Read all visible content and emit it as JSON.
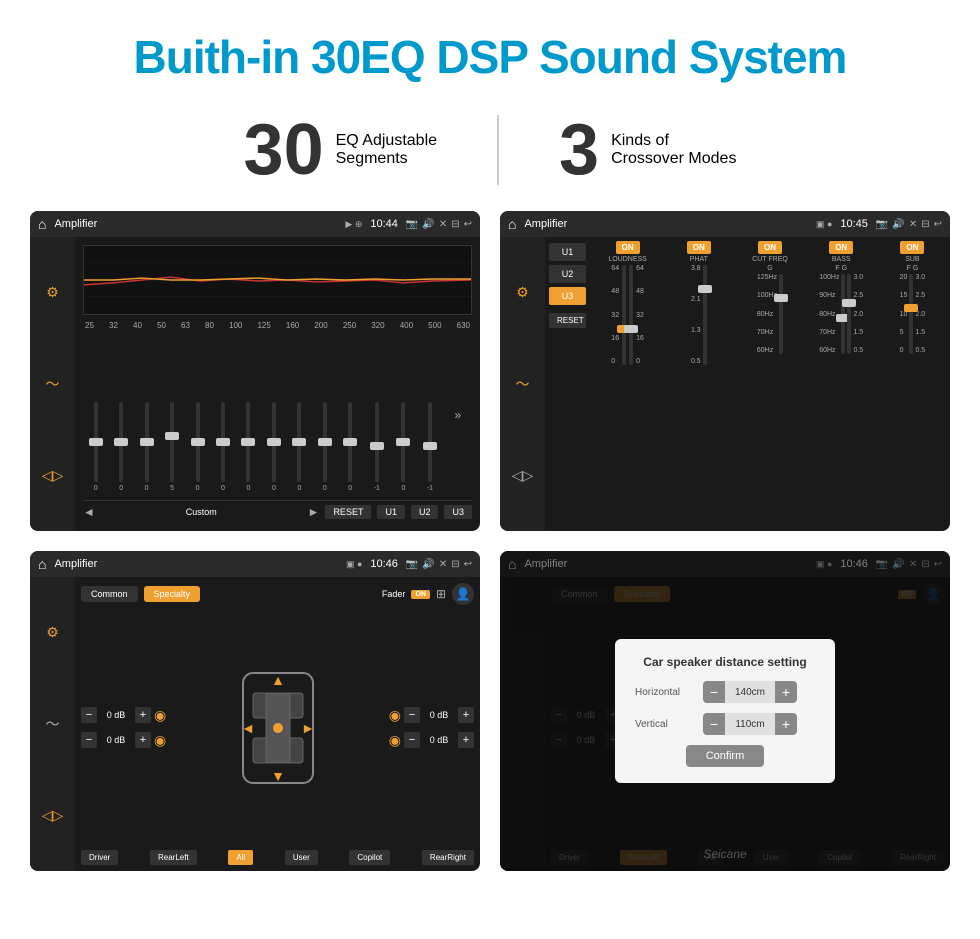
{
  "header": {
    "title": "Buith-in 30EQ DSP Sound System"
  },
  "stats": {
    "eq_number": "30",
    "eq_desc_line1": "EQ Adjustable",
    "eq_desc_line2": "Segments",
    "crossover_number": "3",
    "crossover_desc_line1": "Kinds of",
    "crossover_desc_line2": "Crossover Modes"
  },
  "screen1": {
    "title": "Amplifier",
    "time": "10:44",
    "eq_labels": [
      "25",
      "32",
      "40",
      "50",
      "63",
      "80",
      "100",
      "125",
      "160",
      "200",
      "250",
      "320",
      "400",
      "500",
      "630"
    ],
    "sliders": [
      {
        "val": "0",
        "pos": 50
      },
      {
        "val": "0",
        "pos": 50
      },
      {
        "val": "0",
        "pos": 50
      },
      {
        "val": "5",
        "pos": 45
      },
      {
        "val": "0",
        "pos": 50
      },
      {
        "val": "0",
        "pos": 50
      },
      {
        "val": "0",
        "pos": 50
      },
      {
        "val": "0",
        "pos": 50
      },
      {
        "val": "0",
        "pos": 50
      },
      {
        "val": "0",
        "pos": 50
      },
      {
        "val": "0",
        "pos": 50
      },
      {
        "val": "-1",
        "pos": 52
      },
      {
        "val": "0",
        "pos": 50
      },
      {
        "val": "-1",
        "pos": 52
      }
    ],
    "bottom_buttons": [
      "RESET",
      "U1",
      "U2",
      "U3"
    ],
    "custom_label": "Custom"
  },
  "screen2": {
    "title": "Amplifier",
    "time": "10:45",
    "u_buttons": [
      "U1",
      "U2",
      "U3"
    ],
    "active_u": "U3",
    "channels": [
      {
        "name": "LOUDNESS",
        "on": true
      },
      {
        "name": "PHAT",
        "on": true
      },
      {
        "name": "CUT FREQ",
        "on": true
      },
      {
        "name": "BASS",
        "on": true
      },
      {
        "name": "SUB",
        "on": true
      }
    ],
    "reset_label": "RESET"
  },
  "screen3": {
    "title": "Amplifier",
    "time": "10:46",
    "mode_buttons": [
      "Common",
      "Specialty"
    ],
    "active_mode": "Specialty",
    "fader_label": "Fader",
    "fader_on": "ON",
    "db_rows": [
      {
        "val": "0 dB"
      },
      {
        "val": "0 dB"
      },
      {
        "val": "0 dB"
      },
      {
        "val": "0 dB"
      }
    ],
    "zone_buttons": [
      "Driver",
      "RearLeft",
      "All",
      "User",
      "Copilot",
      "RearRight"
    ],
    "active_zone": "All"
  },
  "screen4": {
    "title": "Amplifier",
    "time": "10:46",
    "mode_buttons": [
      "Common",
      "Specialty"
    ],
    "fader_on": "ON",
    "modal": {
      "title": "Car speaker distance setting",
      "horizontal_label": "Horizontal",
      "horizontal_value": "140cm",
      "vertical_label": "Vertical",
      "vertical_value": "110cm",
      "confirm_label": "Confirm"
    },
    "zone_buttons": [
      "Driver",
      "RearLeft",
      "All",
      "User",
      "Copilot",
      "RearRight"
    ]
  },
  "watermark": "Seicane"
}
